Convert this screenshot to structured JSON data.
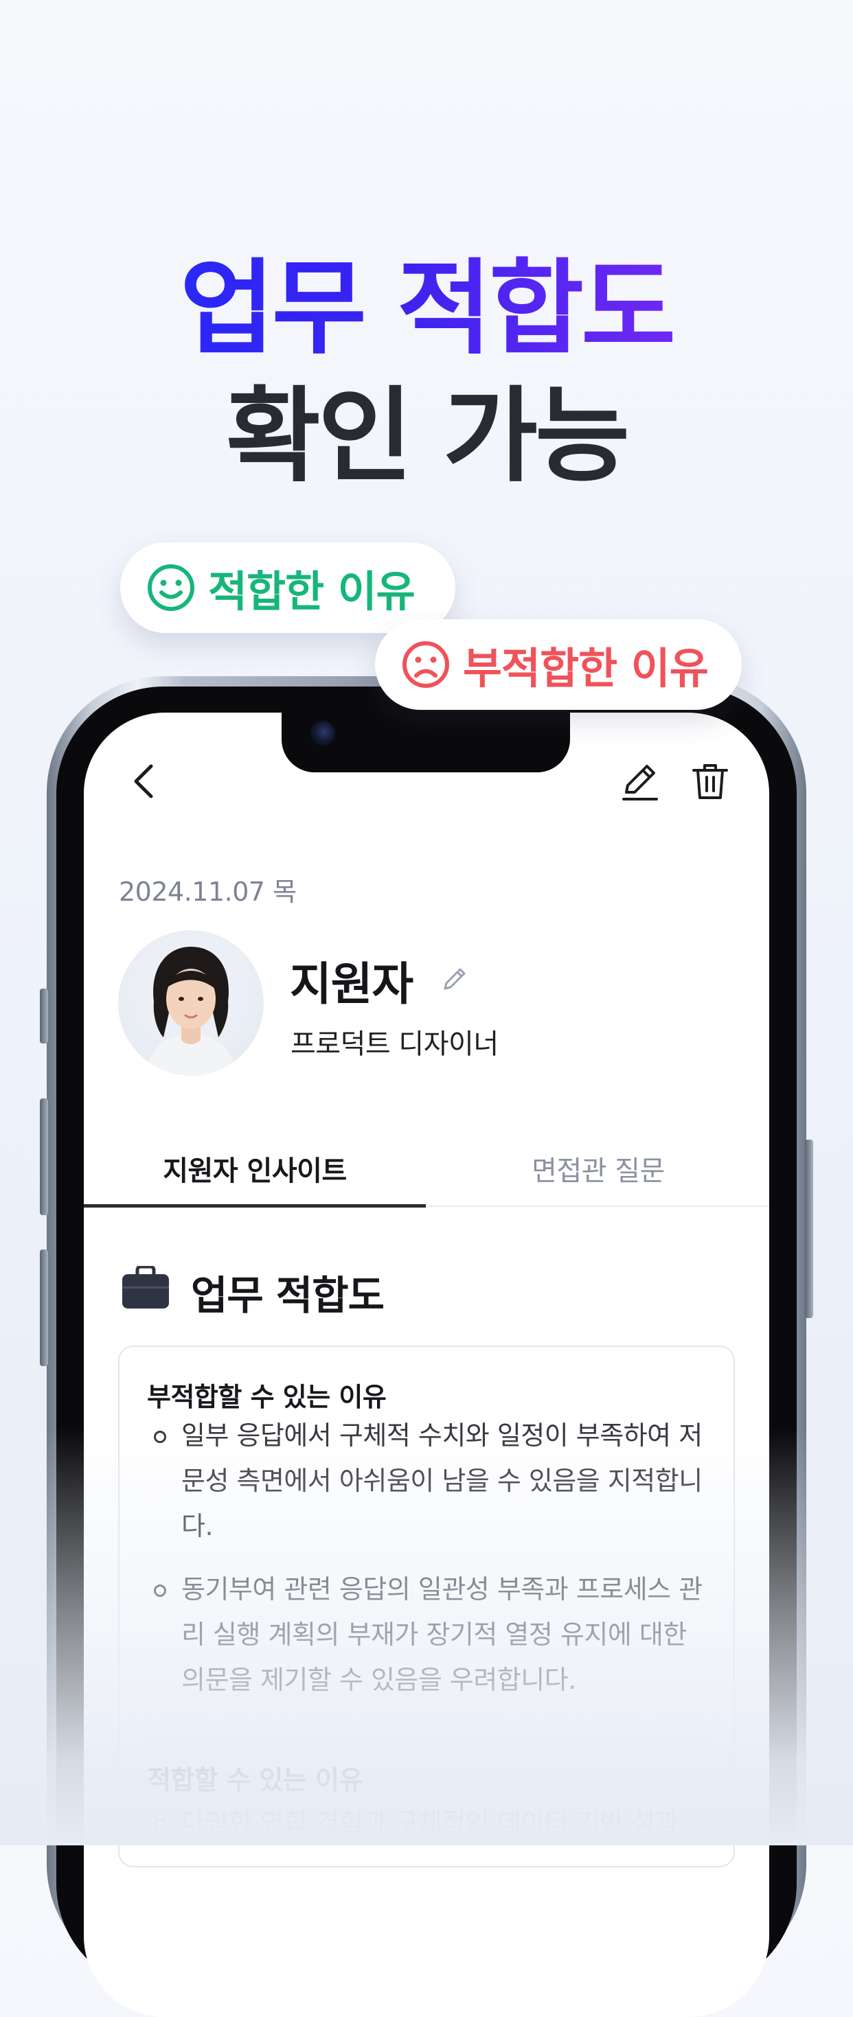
{
  "headline": {
    "line1": "업무 적합도",
    "line2": "확인 가능"
  },
  "chips": {
    "good": {
      "label": "적합한 이유",
      "icon": "smile-icon",
      "color": "#16b67a"
    },
    "bad": {
      "label": "부적합한 이유",
      "icon": "frown-icon",
      "color": "#f0525a"
    }
  },
  "app": {
    "date": "2024.11.07 목",
    "candidate": {
      "name": "지원자",
      "role": "프로덕트 디자이너"
    },
    "tabs": [
      {
        "label": "지원자 인사이트",
        "active": true
      },
      {
        "label": "면접관 질문",
        "active": false
      }
    ],
    "section": {
      "title": "업무 적합도",
      "icon": "briefcase-icon"
    },
    "card": {
      "unfit_heading": "부적합할 수 있는 이유",
      "unfit_items": [
        "일부 응답에서 구체적 수치와 일정이 부족하여 저문성 측면에서 아쉬움이 남을 수 있음을 지적합니다.",
        "동기부여 관련 응답의 일관성 부족과 프로세스 관리 실행 계획의 부재가 장기적 열정 유지에 대한 의문을 제기할 수 있음을 우려합니다."
      ],
      "fit_heading": "적합할 수 있는 이유",
      "fit_items": [
        "다양한 연합 경험과 구체적인 데이터 기반 성과"
      ]
    }
  },
  "colors": {
    "gradient_start": "#1b2dff",
    "gradient_end": "#8f2cf5",
    "headline_dark": "#2a2b30"
  }
}
